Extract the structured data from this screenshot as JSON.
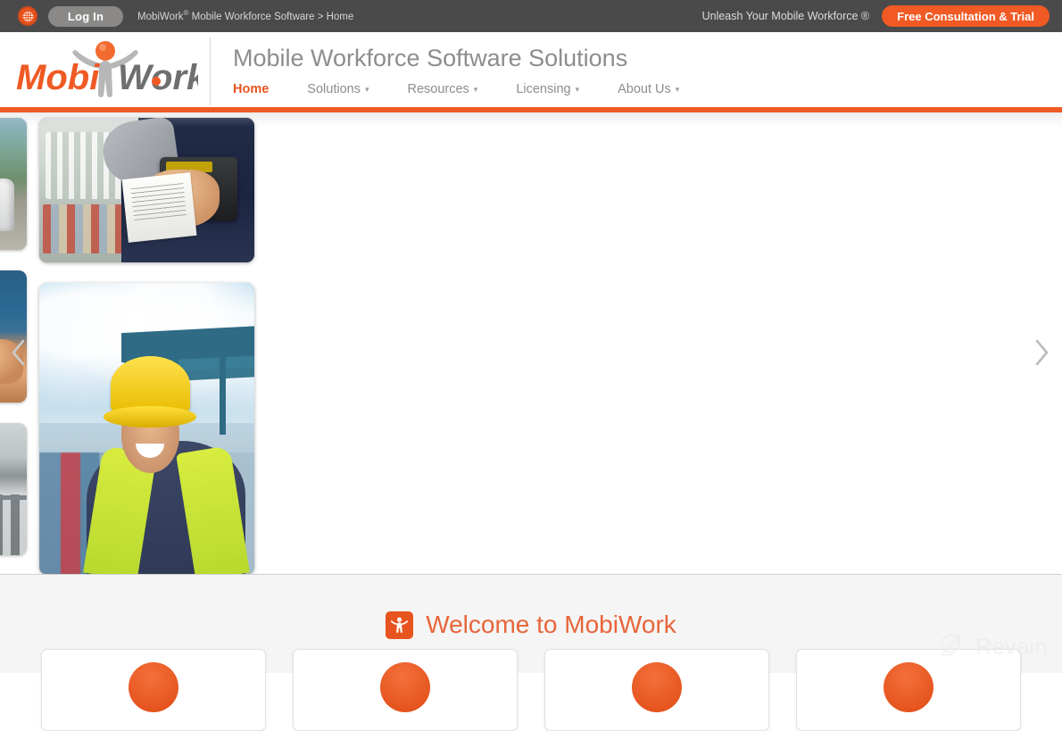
{
  "topbar": {
    "globe_icon": "globe-icon",
    "login_label": "Log In",
    "breadcrumb_brand": "MobiWork",
    "breadcrumb_registered": "®",
    "breadcrumb_rest": " Mobile Workforce Software > Home",
    "tagline": "Unleash Your Mobile Workforce ®",
    "trial_label": "Free Consultation & Trial",
    "bg_color": "#4b4a4a",
    "accent_color": "#f15a24"
  },
  "header": {
    "logo_mobi": "Mobi",
    "logo_work": "Work",
    "site_title": "Mobile Workforce Software Solutions",
    "nav": [
      {
        "label": "Home",
        "has_caret": false,
        "active": true
      },
      {
        "label": "Solutions",
        "caret": "▾",
        "has_caret": true,
        "active": false
      },
      {
        "label": "Resources",
        "caret": "▾",
        "has_caret": true,
        "active": false
      },
      {
        "label": "Licensing",
        "caret": "▾",
        "has_caret": true,
        "active": false
      },
      {
        "label": "About Us",
        "caret": "▾",
        "has_caret": true,
        "active": false
      }
    ],
    "rule_color": "#ee5a24",
    "logo_orange": "#e8541f",
    "logo_gray": "#6f6f6f"
  },
  "hero": {
    "prev_icon": "chevron-left-icon",
    "next_icon": "chevron-right-icon",
    "thumbnails": [
      {
        "name": "thumbnail-delivery-truck"
      },
      {
        "name": "thumbnail-hand-device"
      },
      {
        "name": "thumbnail-warehouse-shelves"
      }
    ],
    "slides": [
      {
        "name": "slide-technician-scanner"
      },
      {
        "name": "slide-port-worker-hardhat"
      }
    ]
  },
  "welcome": {
    "icon": "mobiwork-person-icon",
    "title": "Welcome to MobiWork",
    "title_color": "#e8653a",
    "bg_color": "#f5f5f5"
  },
  "feature_cards": [
    {
      "icon": "circle-feature-icon-1"
    },
    {
      "icon": "circle-feature-icon-2"
    },
    {
      "icon": "circle-feature-icon-3"
    },
    {
      "icon": "circle-feature-icon-4"
    }
  ],
  "watermark": {
    "icon": "revain-logo-icon",
    "text": "Revain"
  }
}
